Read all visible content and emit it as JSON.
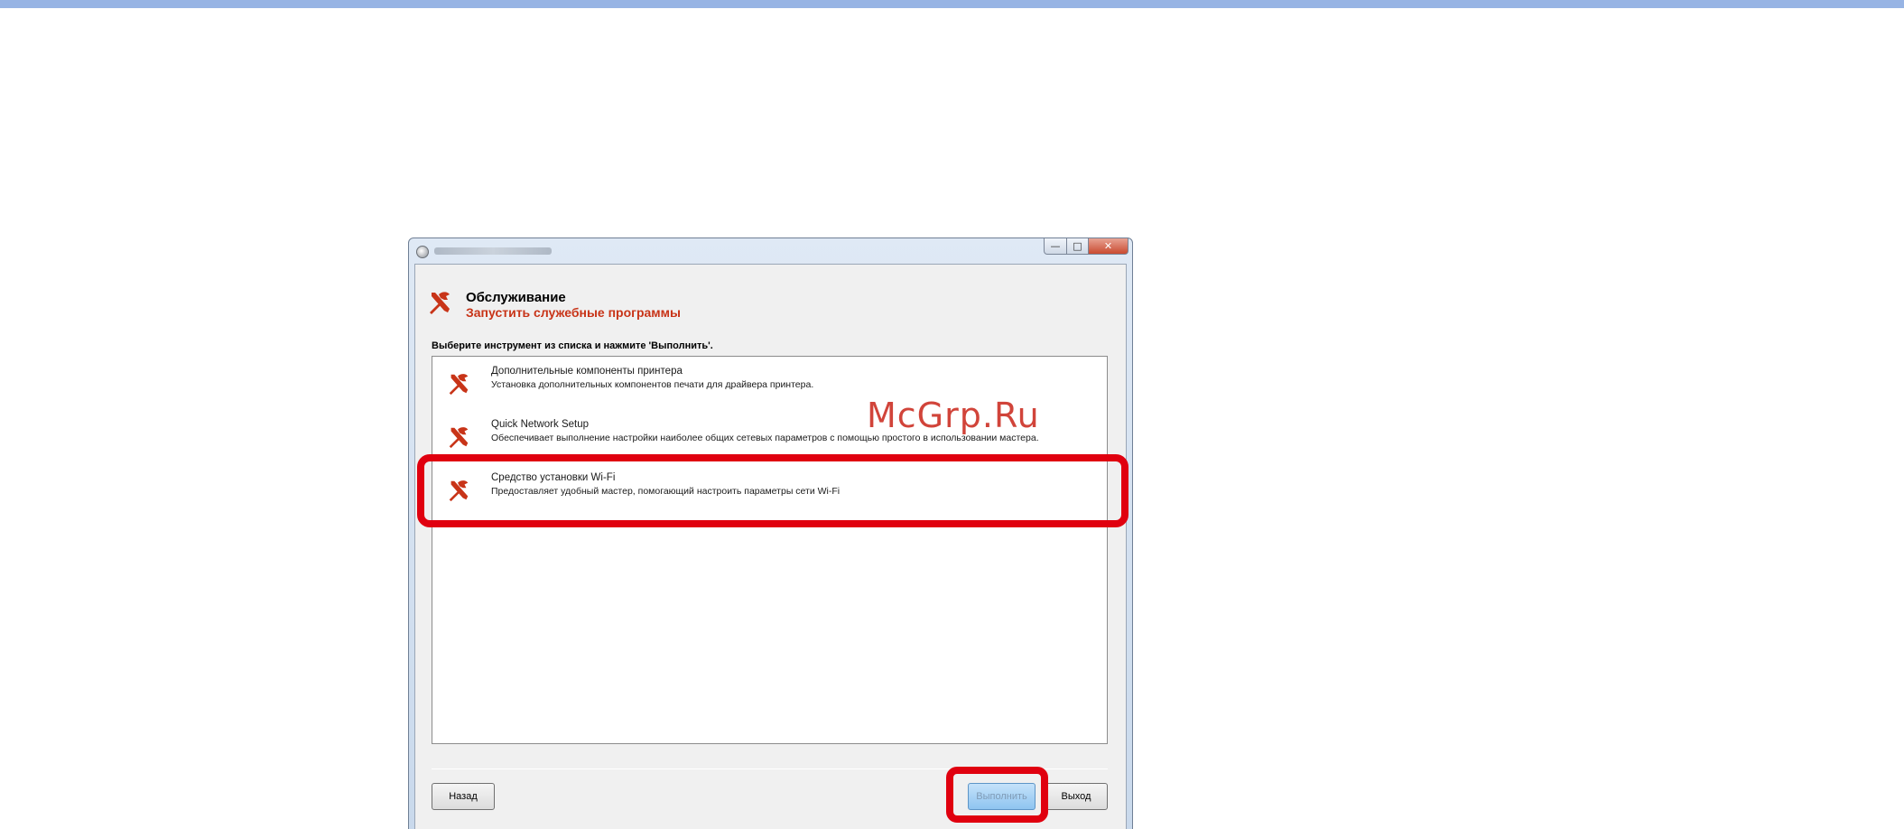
{
  "header": {
    "title": "Обслуживание",
    "subtitle": "Запустить служебные программы"
  },
  "instruction": "Выберите инструмент из списка и нажмите 'Выполнить'.",
  "tools": [
    {
      "name": "Дополнительные компоненты принтера",
      "description": "Установка дополнительных компонентов печати для драйвера принтера.",
      "icon": "tools-icon"
    },
    {
      "name": "Quick Network Setup",
      "description": "Обеспечивает выполнение настройки наиболее общих сетевых параметров с помощью простого в использовании мастера.",
      "icon": "tools-icon"
    },
    {
      "name": "Средство установки Wi-Fi",
      "description": "Предоставляет удобный мастер, помогающий настроить параметры сети Wi-Fi",
      "icon": "tools-icon"
    }
  ],
  "buttons": {
    "back": "Назад",
    "run": "Выполнить",
    "exit": "Выход"
  },
  "watermark": "McGrp.Ru",
  "colors": {
    "accent_red": "#c83418",
    "highlight": "#e0000f",
    "top_bar": "#97b4e4"
  }
}
